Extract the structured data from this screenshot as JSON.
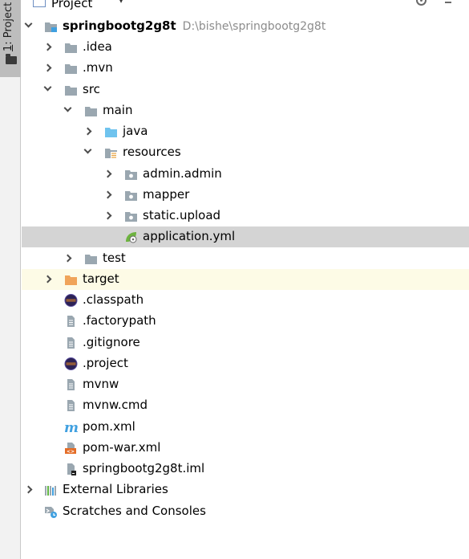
{
  "side_stripe": {
    "label_prefix": "1",
    "label": ": Project"
  },
  "header": {
    "title": "Project",
    "caret": "▾"
  },
  "tree": [
    {
      "name": "springbootg2g8t",
      "path": "D:\\bishe\\springbootg2g8t",
      "bold": true,
      "arrow": "down",
      "icon": "module-folder-icon"
    },
    {
      "name": ".idea",
      "arrow": "right",
      "icon": "folder-icon"
    },
    {
      "name": ".mvn",
      "arrow": "right",
      "icon": "folder-icon"
    },
    {
      "name": "src",
      "arrow": "down",
      "icon": "folder-icon"
    },
    {
      "name": "main",
      "arrow": "down",
      "icon": "folder-icon"
    },
    {
      "name": "java",
      "arrow": "right",
      "icon": "source-folder-icon"
    },
    {
      "name": "resources",
      "arrow": "down",
      "icon": "resources-folder-icon"
    },
    {
      "name": "admin.admin",
      "arrow": "right",
      "icon": "package-folder-icon"
    },
    {
      "name": "mapper",
      "arrow": "right",
      "icon": "package-folder-icon"
    },
    {
      "name": "static.upload",
      "arrow": "right",
      "icon": "package-folder-icon"
    },
    {
      "name": "application.yml",
      "arrow": "none",
      "icon": "spring-config-icon",
      "selected": true
    },
    {
      "name": "test",
      "arrow": "right",
      "icon": "folder-icon"
    },
    {
      "name": "target",
      "arrow": "right",
      "icon": "excluded-folder-icon",
      "excluded": true
    },
    {
      "name": ".classpath",
      "arrow": "none",
      "icon": "eclipse-icon"
    },
    {
      "name": ".factorypath",
      "arrow": "none",
      "icon": "file-icon"
    },
    {
      "name": ".gitignore",
      "arrow": "none",
      "icon": "file-icon"
    },
    {
      "name": ".project",
      "arrow": "none",
      "icon": "eclipse-icon"
    },
    {
      "name": "mvnw",
      "arrow": "none",
      "icon": "file-icon"
    },
    {
      "name": "mvnw.cmd",
      "arrow": "none",
      "icon": "file-icon"
    },
    {
      "name": "pom.xml",
      "arrow": "none",
      "icon": "maven-icon"
    },
    {
      "name": "pom-war.xml",
      "arrow": "none",
      "icon": "xml-file-icon"
    },
    {
      "name": "springbootg2g8t.iml",
      "arrow": "none",
      "icon": "iml-file-icon"
    },
    {
      "name": "External Libraries",
      "arrow": "right",
      "icon": "libraries-icon"
    },
    {
      "name": "Scratches and Consoles",
      "arrow": "none",
      "icon": "scratches-icon"
    }
  ]
}
